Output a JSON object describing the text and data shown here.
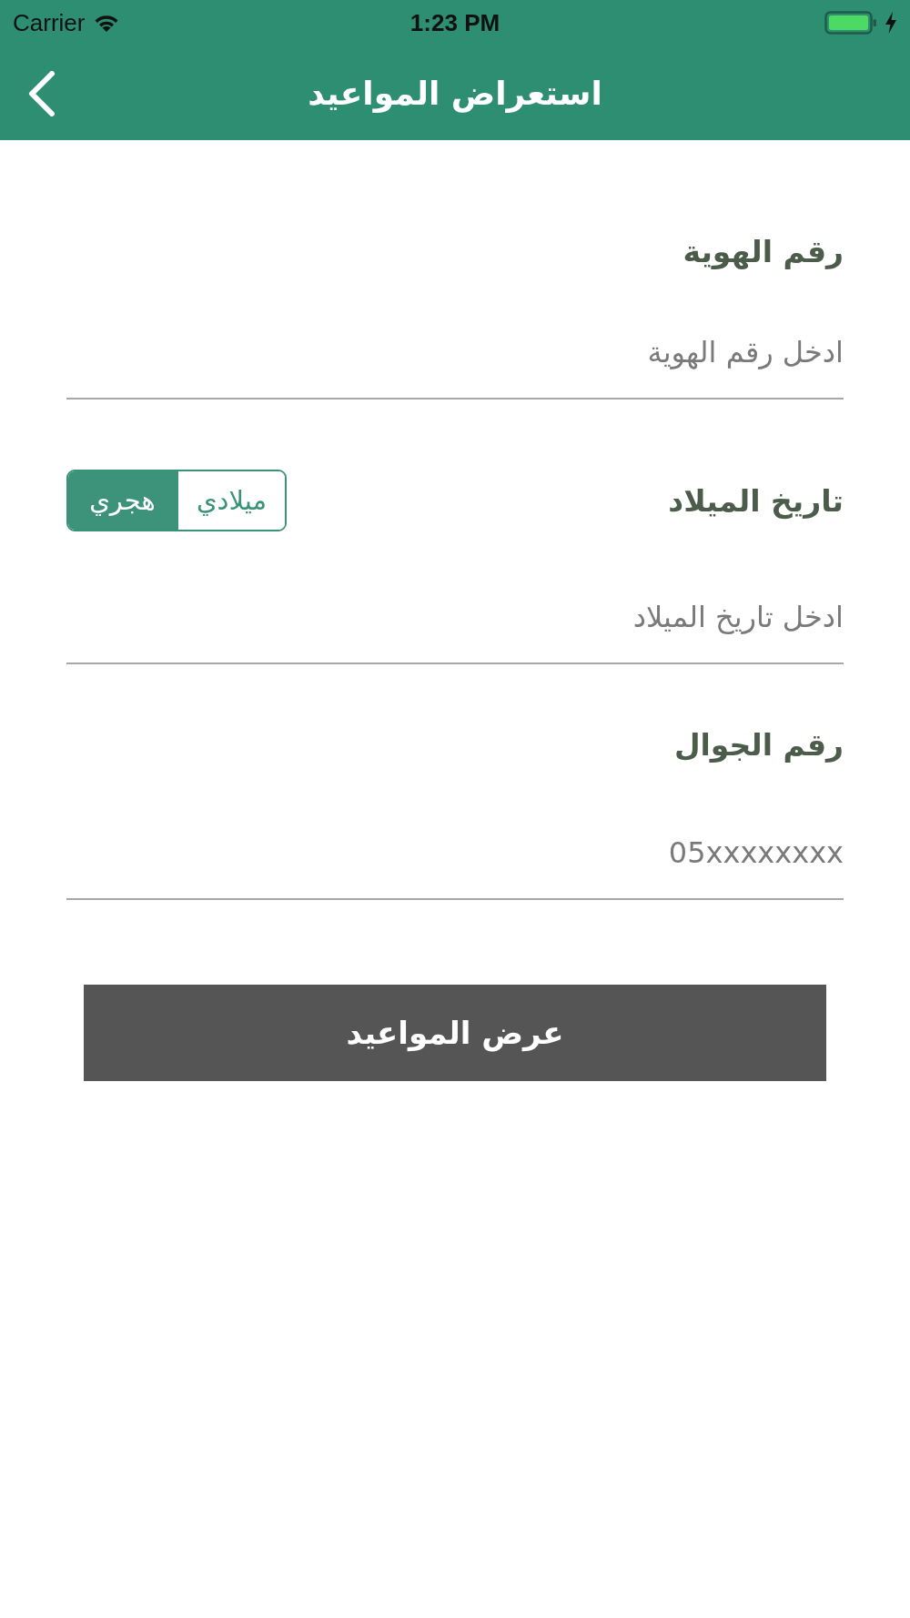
{
  "status_bar": {
    "carrier": "Carrier",
    "time": "1:23 PM"
  },
  "nav_bar": {
    "title": "استعراض المواعيد"
  },
  "form": {
    "fields": [
      {
        "label": "رقم الهوية",
        "placeholder": "ادخل رقم الهوية"
      },
      {
        "label": "تاريخ الميلاد",
        "placeholder": "ادخل تاريخ الميلاد",
        "calendar_toggle": [
          {
            "label": "ميلادي",
            "selected": false
          },
          {
            "label": "هجري",
            "selected": true
          }
        ]
      },
      {
        "label": "رقم الجوال",
        "placeholder": "05xxxxxxxx"
      }
    ]
  },
  "submit_button": {
    "label": "عرض المواعيد"
  }
}
